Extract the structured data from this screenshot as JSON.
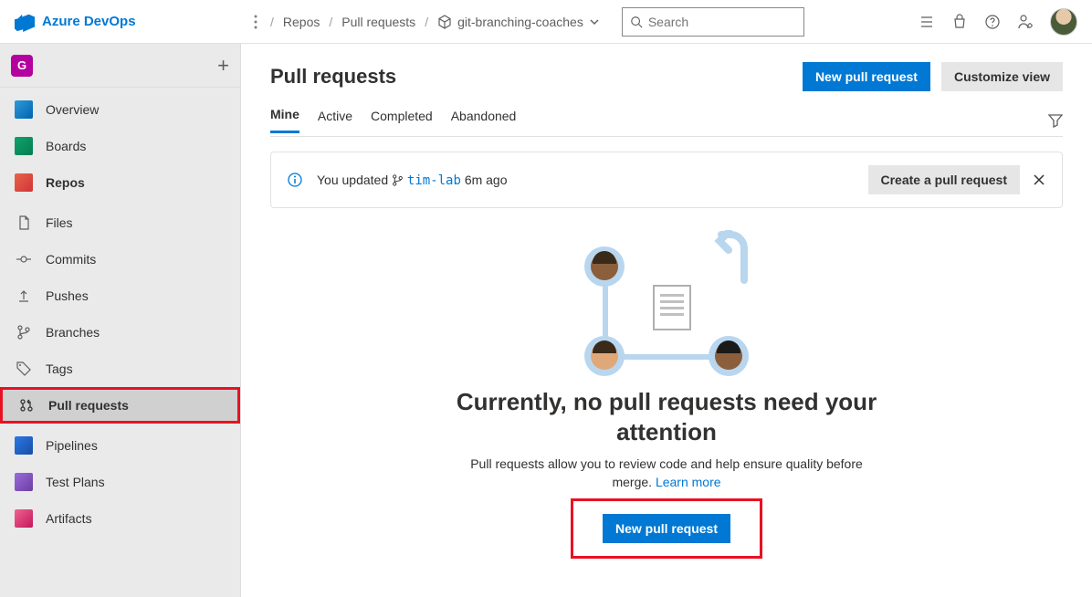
{
  "brand": "Azure DevOps",
  "breadcrumbs": {
    "repos": "Repos",
    "pr": "Pull requests"
  },
  "repoSelector": "git-branching-coaches",
  "search": {
    "placeholder": "Search"
  },
  "project": {
    "initial": "G"
  },
  "sidebar": {
    "overview": "Overview",
    "boards": "Boards",
    "repos": "Repos",
    "files": "Files",
    "commits": "Commits",
    "pushes": "Pushes",
    "branches": "Branches",
    "tags": "Tags",
    "pullrequests": "Pull requests",
    "pipelines": "Pipelines",
    "testplans": "Test Plans",
    "artifacts": "Artifacts"
  },
  "page": {
    "title": "Pull requests",
    "newPr": "New pull request",
    "customize": "Customize view"
  },
  "tabs": {
    "mine": "Mine",
    "active": "Active",
    "completed": "Completed",
    "abandoned": "Abandoned"
  },
  "notice": {
    "prefix": "You updated ",
    "branch": "tim-lab",
    "time": " 6m ago",
    "createBtn": "Create a pull request"
  },
  "empty": {
    "headline": "Currently, no pull requests need your attention",
    "body": "Pull requests allow you to review code and help ensure quality before merge. ",
    "learn": "Learn more",
    "cta": "New pull request"
  }
}
